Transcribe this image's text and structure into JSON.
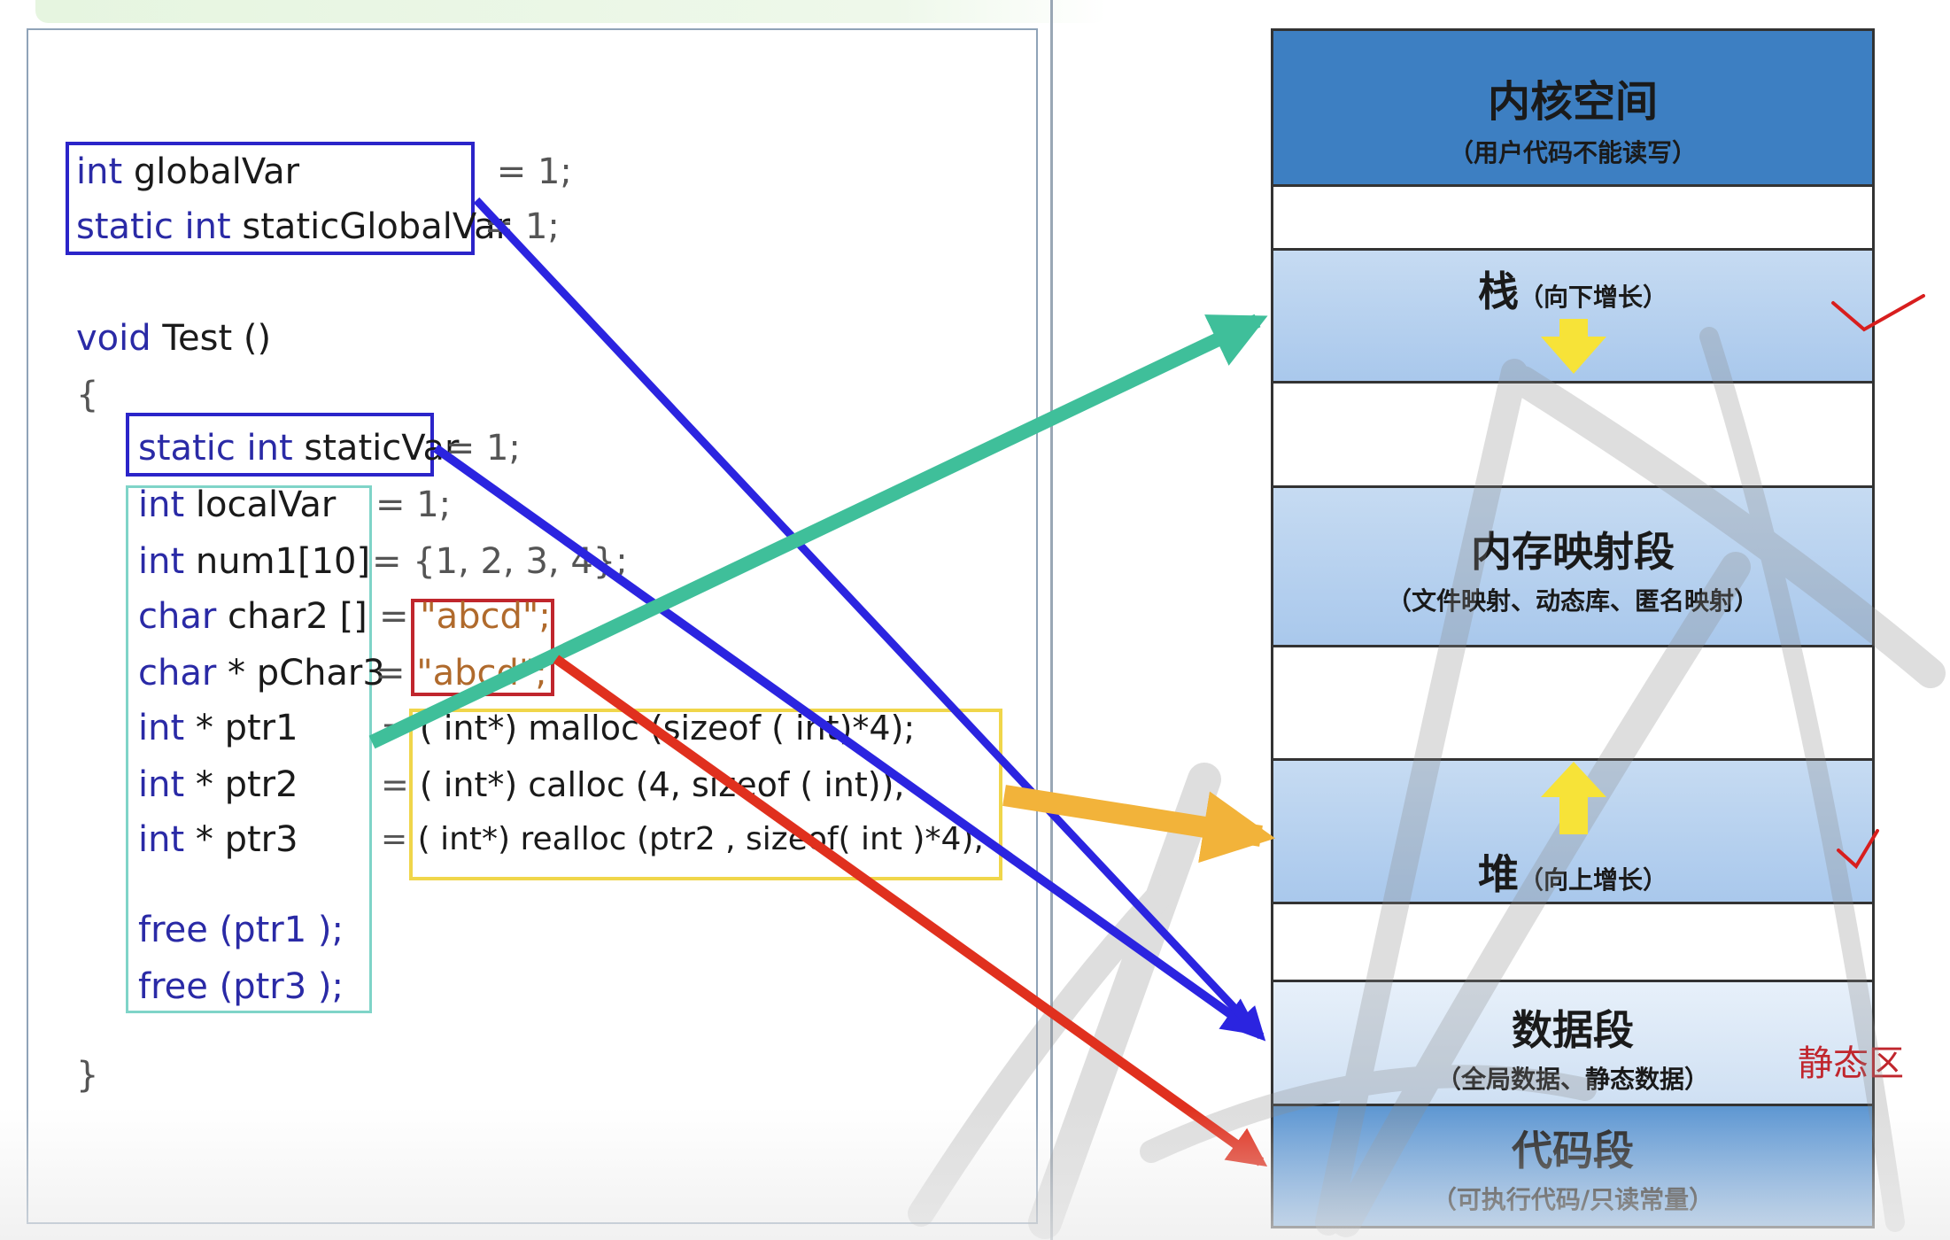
{
  "code": {
    "line_global_var": {
      "kw": "int",
      "name": " globalVar",
      "rest": " = 1;"
    },
    "line_static_global_var": {
      "kw": "static int",
      "name": " staticGlobalVar",
      "rest": " = 1;"
    },
    "line_void_test": {
      "kw": "void",
      "name": " Test ()"
    },
    "line_open_brace": "{",
    "line_static_var": {
      "kw": "static int",
      "name": " staticVar",
      "rest": " = 1;"
    },
    "line_local_var": {
      "kw": "int",
      "name": " localVar",
      "rest": "= 1;"
    },
    "line_num1": {
      "kw": "int",
      "name": " num1[10]",
      "rest": "= {1, 2, 3, 4};"
    },
    "line_char2": {
      "kw": "char",
      "name": " char2 []",
      "eq": "= ",
      "str": "\"abcd\";"
    },
    "line_pchar3": {
      "kw": "char",
      "name": " * pChar3",
      "eq": "= ",
      "str": "\"abcd\";"
    },
    "line_ptr1": {
      "kw": "int",
      "name": " * ptr1",
      "eq": "= ",
      "rest": "( int*) malloc (sizeof ( int)*4);"
    },
    "line_ptr2": {
      "kw": "int",
      "name": " * ptr2",
      "eq": "= ",
      "rest": "( int*) calloc (4, sizeof ( int));"
    },
    "line_ptr3": {
      "kw": "int",
      "name": " * ptr3",
      "eq": "= ",
      "rest": "( int*) realloc (ptr2 , sizeof( int )*4);"
    },
    "line_free1": "free (ptr1 );",
    "line_free3": "free (ptr3 );",
    "line_close_brace": "}"
  },
  "memory": {
    "kernel": {
      "title": "内核空间",
      "sub": "（用户代码不能读写）"
    },
    "stack": {
      "title": "栈",
      "sub": "（向下增长）"
    },
    "mmap": {
      "title": "内存映射段",
      "sub": "（文件映射、动态库、匿名映射）"
    },
    "heap": {
      "title": "堆",
      "sub": "（向上增长）"
    },
    "data": {
      "title": "数据段",
      "sub": "（全局数据、静态数据）"
    },
    "code": {
      "title": "代码段",
      "sub": "（可执行代码/只读常量）"
    }
  },
  "static_area_label": "静态区",
  "colors": {
    "blue_arrow": "#2b24e0",
    "teal_arrow": "#3fbf9a",
    "orange_arrow": "#f2b33a",
    "red_arrow": "#e0301e",
    "kernel_fill": "#3d7fc2",
    "check_mark": "#d81e1e"
  }
}
